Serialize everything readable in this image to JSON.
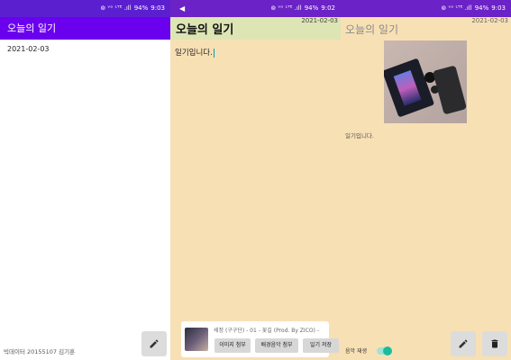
{
  "screen1": {
    "status": {
      "icons": "⊚ ᵛᵒ ᴸᵀᴱ .ıll",
      "battery": "94%",
      "time": "9:03"
    },
    "app_title": "오늘의 일기",
    "list": [
      "2021-02-03"
    ],
    "footer": "빅데이터 20155107 김기훈",
    "fab_icon": "pencil-icon"
  },
  "screen2": {
    "status": {
      "left_icon": "◀",
      "icons": "⊚ ᵛᵒ ᴸᵀᴱ .ıll",
      "battery": "94%",
      "time": "9:02"
    },
    "title": "오늘의 일기",
    "date": "2021-02-03",
    "content": "일기입니다.",
    "song": "세정 (구구단) - 01 - 꽃길 (Prod. By ZICO) -",
    "buttons": {
      "attach_image": "이미지 첨부",
      "attach_music": "배경음악 첨부",
      "save_diary": "일기 저장"
    }
  },
  "screen3": {
    "status": {
      "icons": "⊚ ᵛᵒ ᴸᵀᴱ .ıll",
      "battery": "94%",
      "time": "9:03"
    },
    "title": "오늘의 일기",
    "date": "2021-02-03",
    "content": "일기입니다.",
    "music_toggle_label": "음악 재생",
    "music_playing": true
  }
}
